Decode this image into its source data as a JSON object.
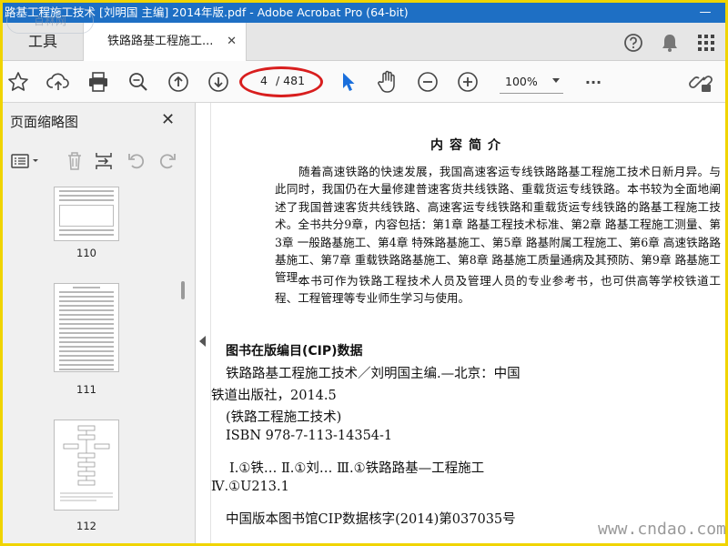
{
  "window": {
    "title": "路基工程施工技术 [刘明国 主编] 2014年版.pdf - Adobe Acrobat Pro (64-bit)",
    "minimize": "—",
    "maximize": "☐",
    "close": "✕"
  },
  "tabs": {
    "tools": "工具",
    "document": "铁路路基工程施工...",
    "document_close": "✕"
  },
  "toolbar": {
    "current_page": "4",
    "total_pages": "/ 481",
    "zoom": "100%",
    "more": "···"
  },
  "sidebar": {
    "title": "页面缩略图",
    "close": "✕",
    "thumbnails": [
      {
        "label": "110"
      },
      {
        "label": "111"
      },
      {
        "label": "112"
      }
    ]
  },
  "document": {
    "heading": "内容简介",
    "paragraphs": [
      "随着高速铁路的快速发展，我国高速客运专线铁路路基工程施工技术日新月异。与此同时，我国仍在大量修建普速客货共线铁路、重载货运专线铁路。本书较为全面地阐述了我国普速客货共线铁路、高速客运专线铁路和重载货运专线铁路的路基工程施工技术。全书共分9章，内容包括：第1章 路基工程技术标准、第2章 路基工程施工测量、第3章 一般路基施工、第4章 特殊路基施工、第5章 路基附属工程施工、第6章 高速铁路路基施工、第7章 重载铁路路基施工、第8章 路基施工质量通病及其预防、第9章 路基施工管理。",
      "本书可作为铁路工程技术人员及管理人员的专业参考书，也可供高等学校铁道工程、工程管理等专业师生学习与使用。"
    ],
    "cip_title": "图书在版编目(CIP)数据",
    "cip_lines": [
      "铁路路基工程施工技术／刘明国主编.—北京：中国",
      "铁道出版社，2014.5",
      "(铁路工程施工技术)",
      "ISBN 978-7-113-14354-1",
      "Ⅰ.①铁…  Ⅱ.①刘…  Ⅲ.①铁路路基—工程施工",
      "Ⅳ.①U213.1",
      "中国版本图书馆CIP数据核字(2014)第037035号"
    ]
  },
  "watermark": {
    "site": "www.cndao.com",
    "logo": "百林网"
  },
  "colors": {
    "titlebar": "#1e6fc4",
    "frame": "#f0d400",
    "annotation": "#d81e1e",
    "select_tool": "#1a6fdc"
  }
}
